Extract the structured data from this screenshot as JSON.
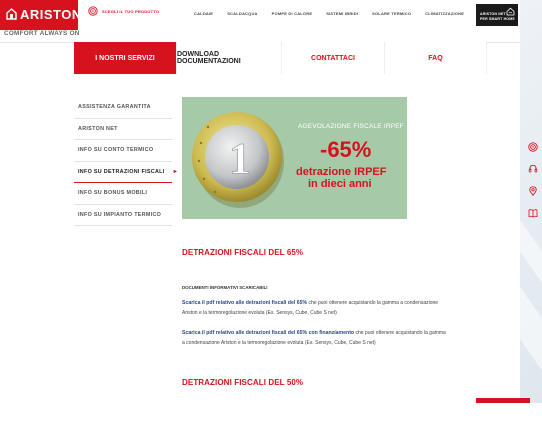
{
  "brand": {
    "logo": "ARISTON",
    "tagline": "COMFORT ALWAYS ON"
  },
  "header": {
    "choose_label": "SCEGLI IL TUO PRODOTTO",
    "nav": [
      "CALDAIE",
      "SCALDACQUA",
      "POMPE DI CALORE",
      "SISTEMI IBRIDI",
      "SOLARE TERMICO",
      "CLIMATIZZAZIONE"
    ],
    "ariston_net_line1": "ARISTON NET",
    "ariston_net_line2": "PER SMART HOME"
  },
  "menubar": {
    "items": [
      "I NOSTRI SERVIZI",
      "DOWNLOAD DOCUMENTAZIONI",
      "CONTATTACI",
      "FAQ"
    ],
    "active": "I NOSTRI SERVIZI"
  },
  "sidebar": {
    "items": [
      "ASSISTENZA GARANTITA",
      "ARISTON NET",
      "INFO SU CONTO TERMICO",
      "INFO SU DETRAZIONI FISCALI",
      "INFO SU BONUS MOBILI",
      "INFO SU IMPIANTO TERMICO"
    ],
    "active": "INFO SU DETRAZIONI FISCALI"
  },
  "banner": {
    "subtitle": "AGEVOLAZIONE FISCALE IRPEF",
    "percent": "-65%",
    "line1": "detrazione IRPEF",
    "line2": "in dieci anni",
    "coin_value": "1"
  },
  "content": {
    "heading1": "DETRAZIONI FISCALI  DEL 65%",
    "docs_label": "DOCUMENTI INFORMATIVI SCARICABILI",
    "p1_link": "Scarica il pdf relativo alle detrazioni fiscali del 65%",
    "p1_text1": " che puoi ottenere acquistando la gamma a condensazione",
    "p1_text2": "Ariston e la termoregolazione evoluta (Es. Sensys, Cube, Cube S net)",
    "p2_link": "Scarica il pdf relativo alle detrazioni fiscali del 65% con finanziamento",
    "p2_text1": " che puoi ottenere acquistando la gamma",
    "p2_text2": "a condensazione Ariston e la termoregolazione evoluta (Es. Sensys, Cube, Cube S net)",
    "heading2": "DETRAZIONI FISCALI DEL 50%"
  },
  "side_icons": [
    "target-icon",
    "headset-icon",
    "location-pin-icon",
    "book-icon"
  ],
  "colors": {
    "brand_red": "#d6121f",
    "link_blue": "#2a4a8a",
    "banner_green": "#a6c9a8"
  }
}
